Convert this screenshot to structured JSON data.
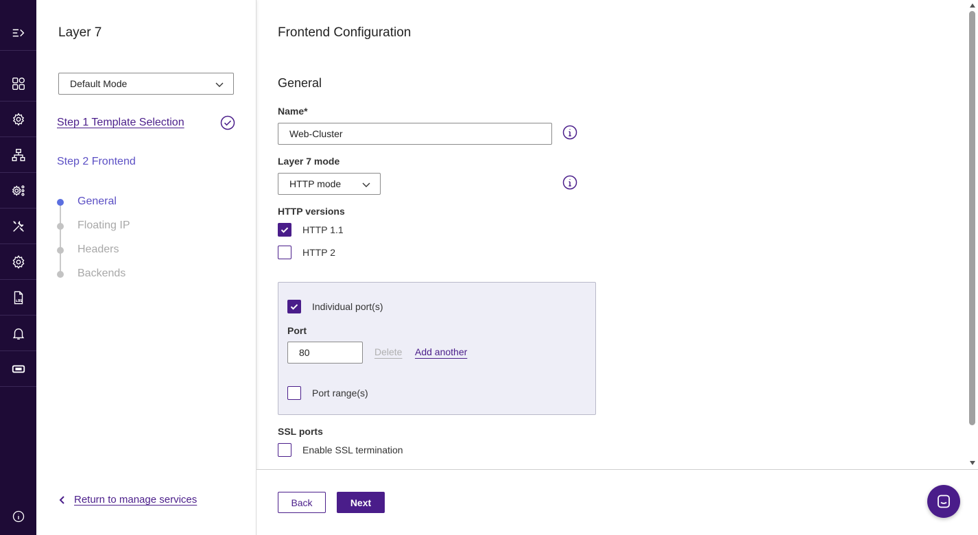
{
  "rail": {
    "items": [
      {
        "icon": "expand-menu-icon"
      },
      {
        "icon": "dashboard-grid-icon"
      },
      {
        "icon": "services-cog-icon"
      },
      {
        "icon": "network-topology-icon"
      },
      {
        "icon": "advanced-settings-icon"
      },
      {
        "icon": "tools-icon"
      },
      {
        "icon": "settings-gear-icon"
      },
      {
        "icon": "log-file-icon"
      },
      {
        "icon": "notification-bell-icon"
      },
      {
        "icon": "ticket-icon"
      }
    ],
    "bottom_icon": "info-icon"
  },
  "sidebar": {
    "title": "Layer 7",
    "mode_select": "Default Mode",
    "step1": "Step 1 Template Selection",
    "step2": "Step 2 Frontend",
    "substeps": [
      "General",
      "Floating IP",
      "Headers",
      "Backends"
    ],
    "return_link": "Return to manage services"
  },
  "main": {
    "title": "Frontend Configuration",
    "section": "General",
    "name_label": "Name*",
    "name_value": "Web-Cluster",
    "layer7_label": "Layer 7 mode",
    "layer7_value": "HTTP mode",
    "http_versions_label": "HTTP versions",
    "http11": "HTTP 1.1",
    "http2": "HTTP 2",
    "individual_ports": "Individual port(s)",
    "port_label": "Port",
    "port_value": "80",
    "delete_link": "Delete",
    "add_link": "Add another",
    "port_range": "Port range(s)",
    "ssl_label": "SSL ports",
    "ssl_enable": "Enable SSL termination"
  },
  "footer": {
    "back": "Back",
    "next": "Next"
  },
  "colors": {
    "accent": "#4a1d8a",
    "rail_bg": "#1e0b36",
    "step_active": "#5b4fc4",
    "port_box_bg": "#eeeef7"
  }
}
